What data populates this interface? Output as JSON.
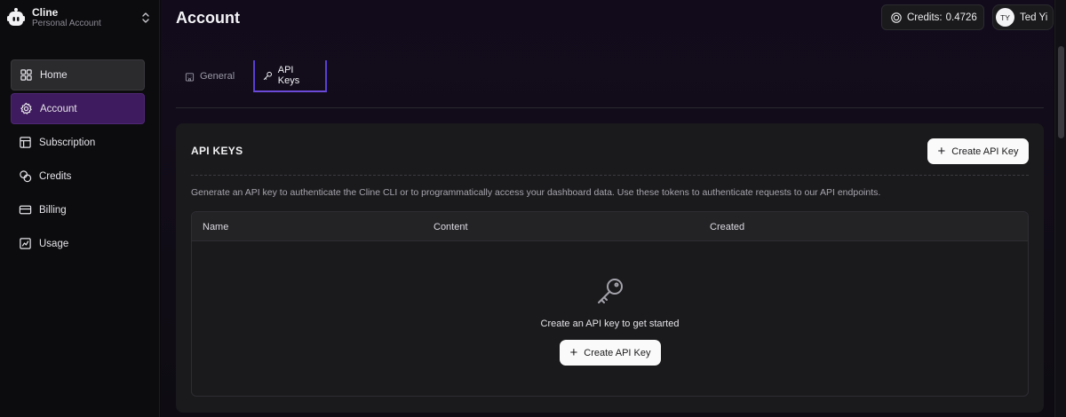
{
  "org": {
    "name": "Cline",
    "subtitle": "Personal Account"
  },
  "sidebar": {
    "items": [
      {
        "label": "Home",
        "icon": "grid-icon"
      },
      {
        "label": "Account",
        "icon": "gear-icon"
      },
      {
        "label": "Subscription",
        "icon": "layout-icon"
      },
      {
        "label": "Credits",
        "icon": "coins-icon"
      },
      {
        "label": "Billing",
        "icon": "credit-card-icon"
      },
      {
        "label": "Usage",
        "icon": "chart-icon"
      }
    ]
  },
  "header": {
    "title": "Account",
    "credits_label": "Credits:",
    "credits_value": "0.4726",
    "user_initials": "TY",
    "user_name": "Ted Yi"
  },
  "tabs": [
    {
      "label": "General",
      "icon": "building-icon"
    },
    {
      "label": "API Keys",
      "icon": "key-icon"
    }
  ],
  "api_keys": {
    "title": "API KEYS",
    "create_label": "Create API Key",
    "description": "Generate an API key to authenticate the Cline CLI or to programmatically access your dashboard data. Use these tokens to authenticate requests to our API endpoints.",
    "columns": [
      "Name",
      "Content",
      "Created"
    ],
    "empty_text": "Create an API key to get started",
    "empty_create_label": "Create API Key"
  },
  "colors": {
    "accent": "#5a3fd6",
    "active_nav": "#3e1a5e",
    "card": "#1a1a1c"
  }
}
